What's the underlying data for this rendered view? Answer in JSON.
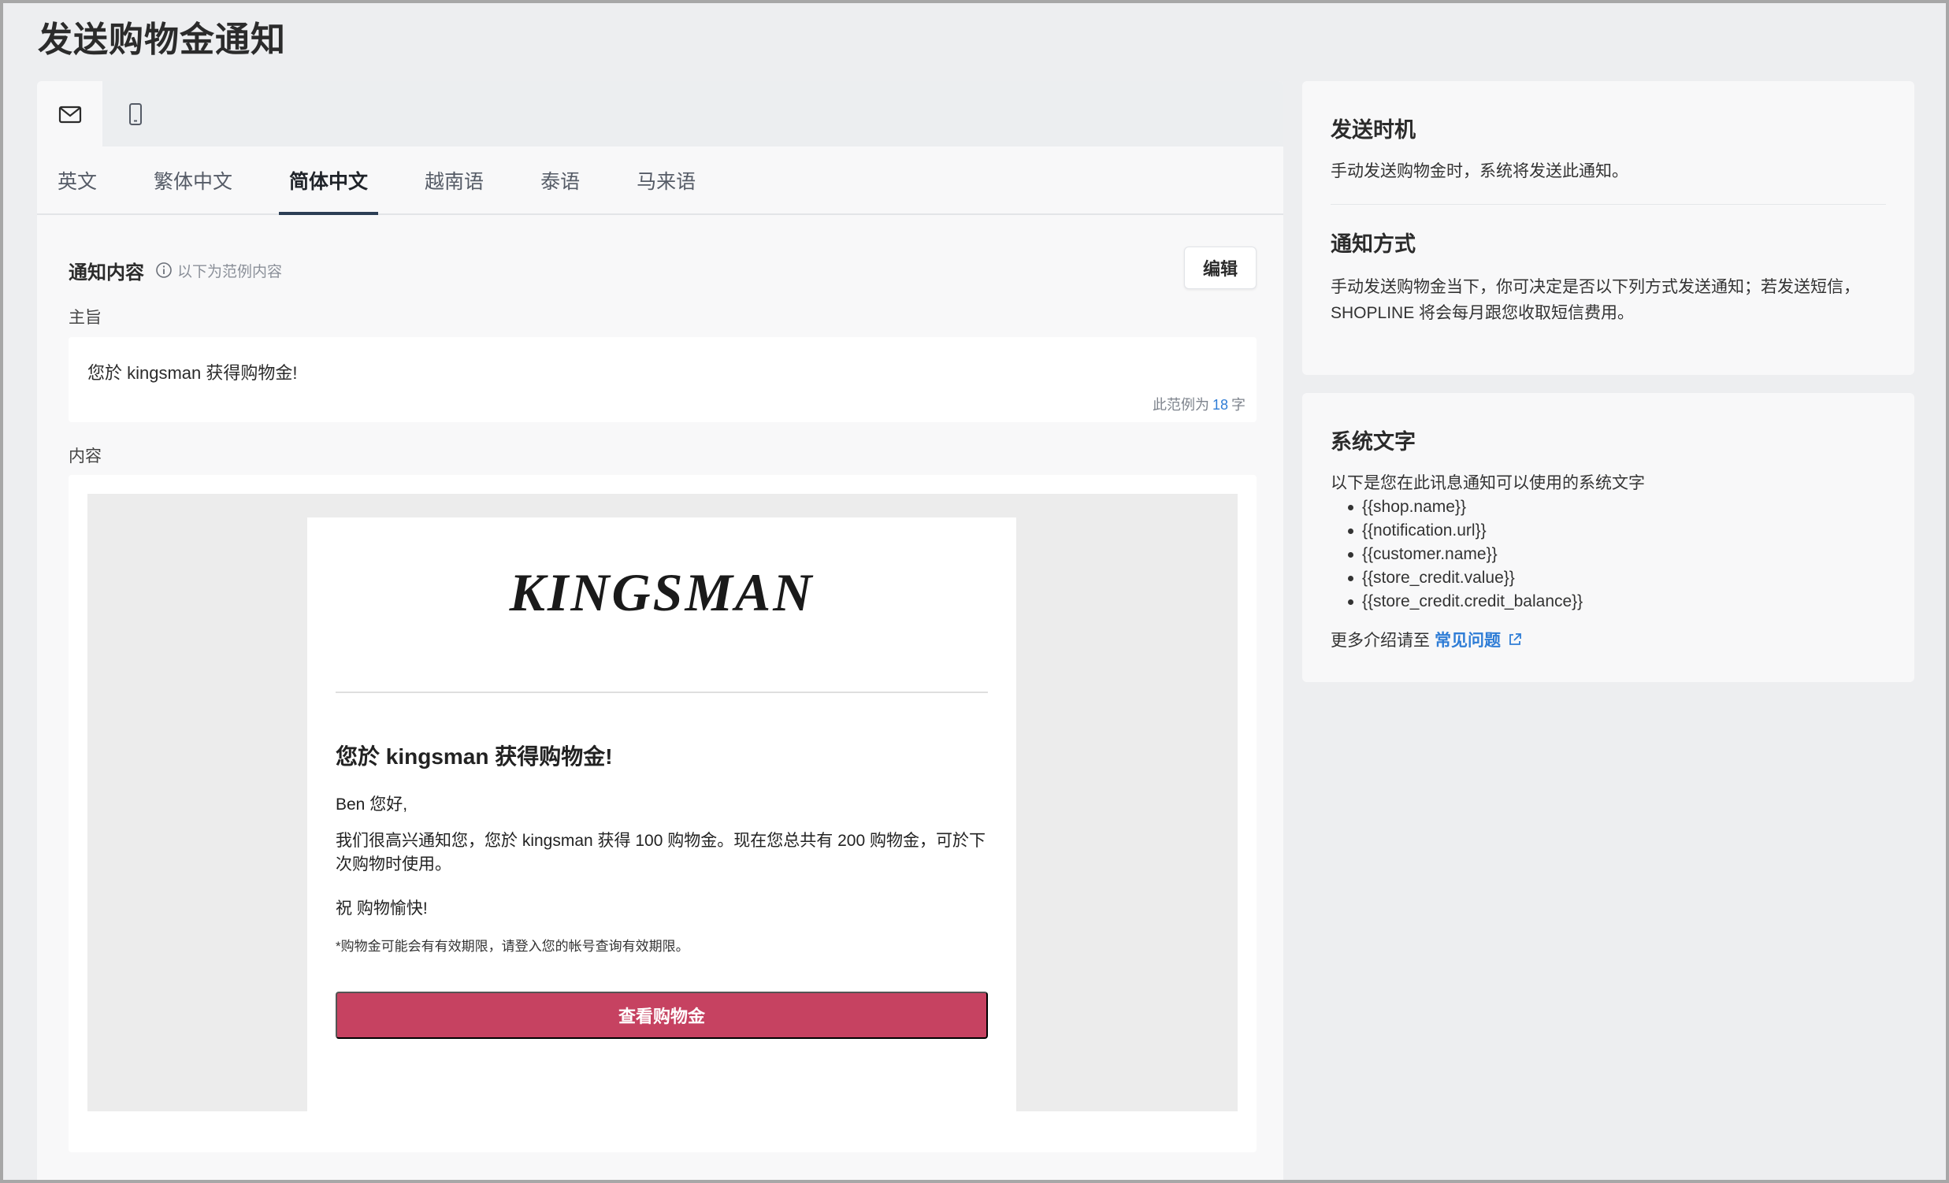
{
  "page": {
    "title": "发送购物金通知"
  },
  "channel_tabs": [
    {
      "name": "email-tab",
      "icon": "envelope-icon",
      "active": true
    },
    {
      "name": "sms-tab",
      "icon": "mobile-phone-icon",
      "active": false
    }
  ],
  "language_tabs": [
    {
      "label": "英文",
      "active": false
    },
    {
      "label": "繁体中文",
      "active": false
    },
    {
      "label": "简体中文",
      "active": true
    },
    {
      "label": "越南语",
      "active": false
    },
    {
      "label": "泰语",
      "active": false
    },
    {
      "label": "马来语",
      "active": false
    }
  ],
  "content": {
    "title": "通知内容",
    "hint": "以下为范例内容",
    "edit_label": "编辑",
    "subject_label": "主旨",
    "subject_value": "您於 kingsman 获得购物金!",
    "char_count_prefix": "此范例为",
    "char_count_value": "18",
    "char_count_suffix": "字",
    "body_label": "内容"
  },
  "email": {
    "logo_text": "KINGSMAN",
    "heading": "您於 kingsman 获得购物金!",
    "greeting": "Ben 您好,",
    "body": "我们很高兴通知您，您於 kingsman 获得 100 购物金。现在您总共有 200 购物金，可於下次购物时使用。",
    "closing": "祝 购物愉快!",
    "note": "*购物金可能会有有效期限，请登入您的帐号查询有效期限。",
    "cta_label": "查看购物金",
    "cta_color": "#c64261"
  },
  "timing_card": {
    "title": "发送时机",
    "text": "手动发送购物金时，系统将发送此通知。",
    "method_title": "通知方式",
    "method_text": "手动发送购物金当下，你可决定是否以下列方式发送通知；若发送短信，SHOPLINE 将会每月跟您收取短信费用。"
  },
  "system_card": {
    "title": "系统文字",
    "intro": "以下是您在此讯息通知可以使用的系统文字",
    "variables": [
      "{{shop.name}}",
      "{{notification.url}}",
      "{{customer.name}}",
      "{{store_credit.value}}",
      "{{store_credit.credit_balance}}"
    ],
    "more_prefix": "更多介绍请至",
    "faq_link": "常见问题"
  }
}
